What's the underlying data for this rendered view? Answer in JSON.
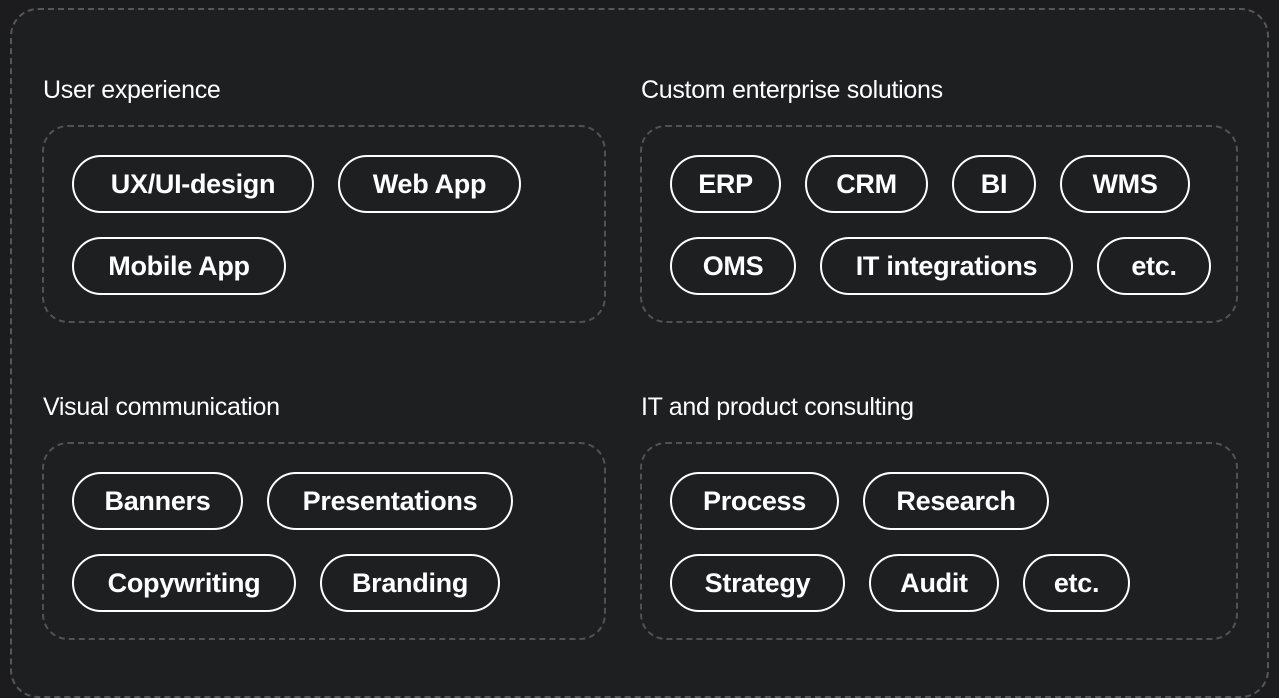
{
  "sections": [
    {
      "title": "User experience",
      "rows": [
        [
          "UX/UI-design",
          "Web App"
        ],
        [
          "Mobile App"
        ]
      ]
    },
    {
      "title": "Custom enterprise solutions",
      "rows": [
        [
          "ERP",
          "CRM",
          "BI",
          "WMS"
        ],
        [
          "OMS",
          "IT integrations",
          "etc."
        ]
      ]
    },
    {
      "title": "Visual communication",
      "rows": [
        [
          "Banners",
          "Presentations"
        ],
        [
          "Copywriting",
          "Branding"
        ]
      ]
    },
    {
      "title": "IT and product consulting",
      "rows": [
        [
          "Process",
          "Research"
        ],
        [
          "Strategy",
          "Audit",
          "etc."
        ]
      ]
    }
  ]
}
